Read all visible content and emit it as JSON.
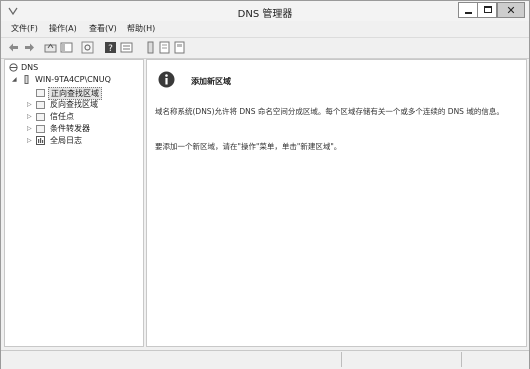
{
  "window": {
    "title": "DNS 管理器"
  },
  "menu": [
    {
      "label": "文件(F)"
    },
    {
      "label": "操作(A)"
    },
    {
      "label": "查看(V)"
    },
    {
      "label": "帮助(H)"
    }
  ],
  "toolbar": [
    "back-icon",
    "forward-icon",
    "up-folder-icon",
    "show-tree-icon",
    "refresh-icon",
    "help-icon",
    "properties-icon",
    "server-icon",
    "zone-icon",
    "records-icon"
  ],
  "tree": {
    "root": "DNS",
    "server": "WIN-9TA4CP\\CNUQ",
    "items": [
      {
        "label": "正向查找区域",
        "selected": true
      },
      {
        "label": "反向查找区域"
      },
      {
        "label": "信任点"
      },
      {
        "label": "条件转发器"
      },
      {
        "label": "全局日志"
      }
    ]
  },
  "content": {
    "heading": "添加新区域",
    "para1": "域名称系统(DNS)允许将 DNS 命名空间分成区域。每个区域存储有关一个或多个连续的 DNS 域的信息。",
    "para2": "要添加一个新区域，请在\"操作\"菜单，单击\"新建区域\"。"
  }
}
